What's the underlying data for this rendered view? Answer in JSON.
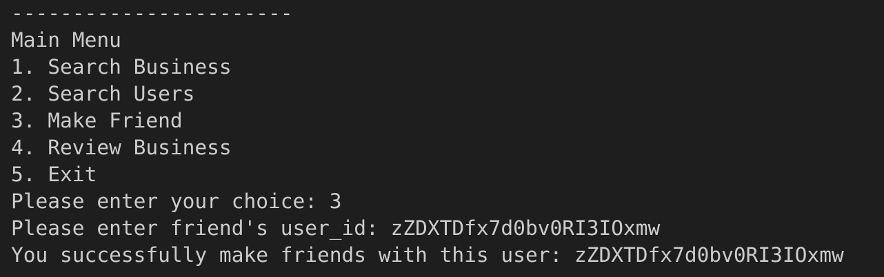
{
  "terminal": {
    "lines": [
      "-----------------------",
      "Main Menu",
      "1. Search Business",
      "2. Search Users",
      "3. Make Friend",
      "4. Review Business",
      "5. Exit",
      "Please enter your choice: 3",
      "Please enter friend's user_id: zZDXTDfx7d0bv0RI3IOxmw",
      "You successfully make friends with this user: zZDXTDfx7d0bv0RI3IOxmw"
    ]
  },
  "colors": {
    "background": "#1e1e1e",
    "text": "#cccccc"
  }
}
